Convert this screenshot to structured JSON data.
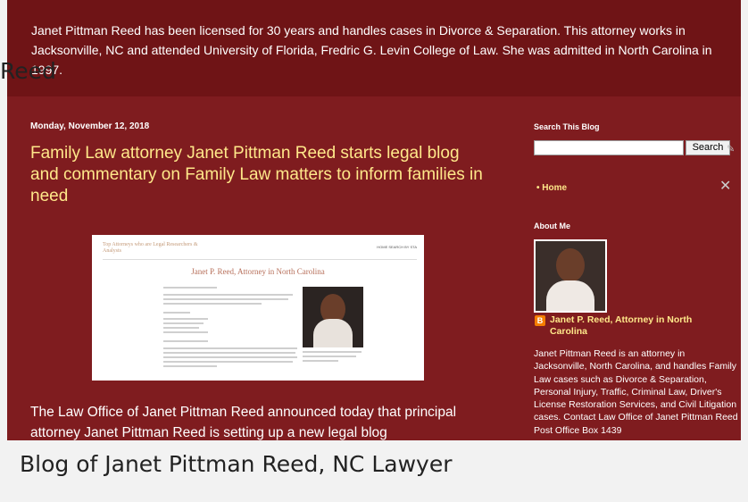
{
  "header": {
    "description": "Janet Pittman Reed has been licensed for 30 years and handles cases in Divorce & Separation. This attorney works in Jacksonville, NC and attended University of Florida, Fredric G. Levin College of Law. She was admitted in North Carolina in 1997.",
    "overlay_title": "Reed"
  },
  "post": {
    "date": "Monday, November 12, 2018",
    "title": "Family Law attorney Janet Pittman Reed starts legal blog and commentary on Family Law matters to inform families in need",
    "body": "The Law Office of Janet Pittman Reed announced today that principal attorney Janet Pittman Reed is setting up a new legal blog",
    "screenshot": {
      "site_name": "Top Attorneys who are Legal Researchers & Analysts",
      "nav": "HOME   SEARCH BY STA",
      "heading": "Janet P. Reed, Attorney in North Carolina"
    }
  },
  "sidebar": {
    "search_title": "Search This Blog",
    "search_button": "Search",
    "home_link": "Home",
    "about_title": "About Me",
    "profile_name": "Janet P. Reed, Attorney in North Carolina",
    "about_text": "Janet Pittman Reed is an attorney in Jacksonville, North Carolina, and handles Family Law cases such as Divorce & Separation, Personal Injury, Traffic, Criminal Law, Driver's License Restoration Services, and Civil Litigation cases. Contact Law Office of Janet Pittman Reed Post Office Box 1439"
  },
  "caption": "Blog of Janet Pittman Reed, NC Lawyer",
  "colors": {
    "background": "#7f1c1f",
    "header": "#6f1416",
    "link": "#ffe88a"
  }
}
